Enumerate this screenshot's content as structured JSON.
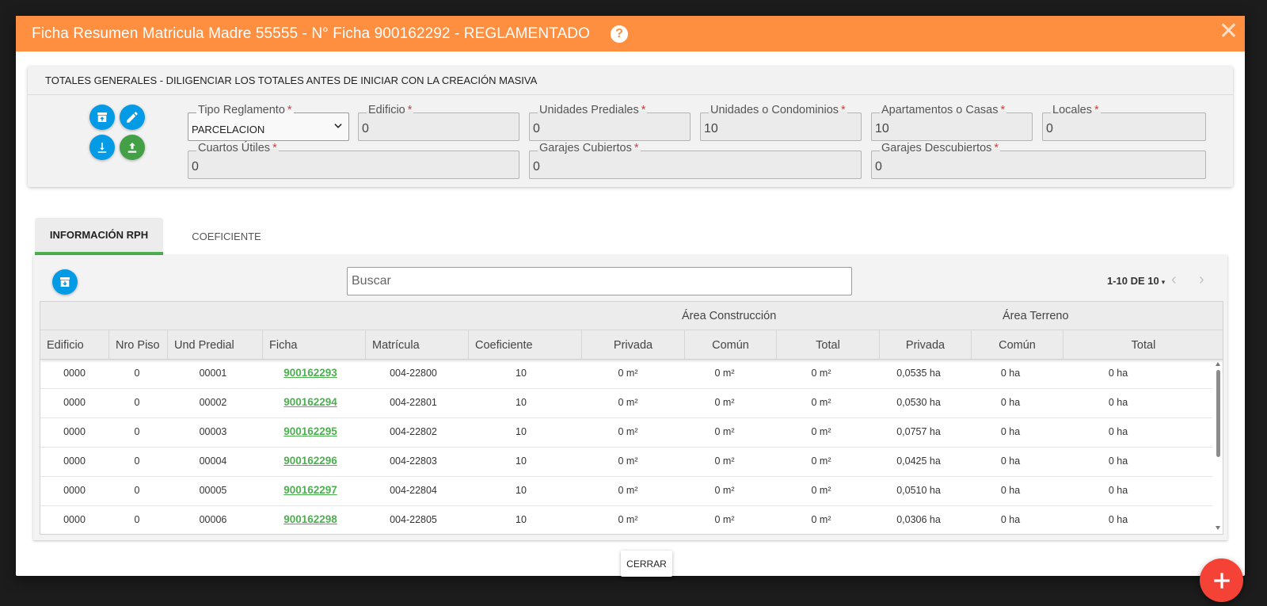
{
  "modal": {
    "title": "Ficha Resumen Matricula Madre 55555 - N° Ficha 900162292 - REGLAMENTADO",
    "help_glyph": "?",
    "close_glyph": "✕"
  },
  "colors": {
    "header": "#ff8f40",
    "accent_green": "#4caf50",
    "action_blue": "#039be5",
    "fab_red": "#f44336"
  },
  "totals": {
    "header": "TOTALES GENERALES - DILIGENCIAR LOS TOTALES ANTES DE INICIAR CON LA CREACIÓN MASIVA",
    "actions": [
      "archive-icon",
      "edit-icon",
      "download-icon",
      "upload-icon"
    ],
    "required_mark": "*",
    "fields": [
      {
        "label": "Tipo Reglamento",
        "value": "PARCELACION"
      },
      {
        "label": "Edificio",
        "value": "0"
      },
      {
        "label": "Unidades Prediales",
        "value": "0"
      },
      {
        "label": "Unidades o Condominios",
        "value": "10"
      },
      {
        "label": "Apartamentos o Casas",
        "value": "10"
      },
      {
        "label": "Locales",
        "value": "0"
      },
      {
        "label": "Cuartos Útiles",
        "value": "0"
      },
      {
        "label": "Garajes Cubiertos",
        "value": "0"
      },
      {
        "label": "Garajes Descubiertos",
        "value": "0"
      }
    ]
  },
  "tabs": [
    {
      "label": "INFORMACIÓN RPH",
      "active": true
    },
    {
      "label": "COEFICIENTE",
      "active": false
    }
  ],
  "table": {
    "search_placeholder": "Buscar",
    "pager": "1-10 DE 10",
    "pager_caret": "▾",
    "prev_glyph": "‹",
    "next_glyph": "›",
    "groups": [
      "Área Construcción",
      "Área Terreno"
    ],
    "columns": [
      "Edificio",
      "Nro Piso",
      "Und Predial",
      "Ficha",
      "Matrícula",
      "Coeficiente",
      "Privada",
      "Común",
      "Total",
      "Privada",
      "Común",
      "Total"
    ],
    "rows": [
      [
        "0000",
        "0",
        "00001",
        "900162293",
        "004-22800",
        "10",
        "0 m²",
        "0 m²",
        "0 m²",
        "0,0535 ha",
        "0 ha",
        "0 ha"
      ],
      [
        "0000",
        "0",
        "00002",
        "900162294",
        "004-22801",
        "10",
        "0 m²",
        "0 m²",
        "0 m²",
        "0,0530 ha",
        "0 ha",
        "0 ha"
      ],
      [
        "0000",
        "0",
        "00003",
        "900162295",
        "004-22802",
        "10",
        "0 m²",
        "0 m²",
        "0 m²",
        "0,0757 ha",
        "0 ha",
        "0 ha"
      ],
      [
        "0000",
        "0",
        "00004",
        "900162296",
        "004-22803",
        "10",
        "0 m²",
        "0 m²",
        "0 m²",
        "0,0425 ha",
        "0 ha",
        "0 ha"
      ],
      [
        "0000",
        "0",
        "00005",
        "900162297",
        "004-22804",
        "10",
        "0 m²",
        "0 m²",
        "0 m²",
        "0,0510 ha",
        "0 ha",
        "0 ha"
      ],
      [
        "0000",
        "0",
        "00006",
        "900162298",
        "004-22805",
        "10",
        "0 m²",
        "0 m²",
        "0 m²",
        "0,0306 ha",
        "0 ha",
        "0 ha"
      ]
    ]
  },
  "footer": {
    "close_label": "CERRAR",
    "fab_icon": "plus-icon"
  }
}
